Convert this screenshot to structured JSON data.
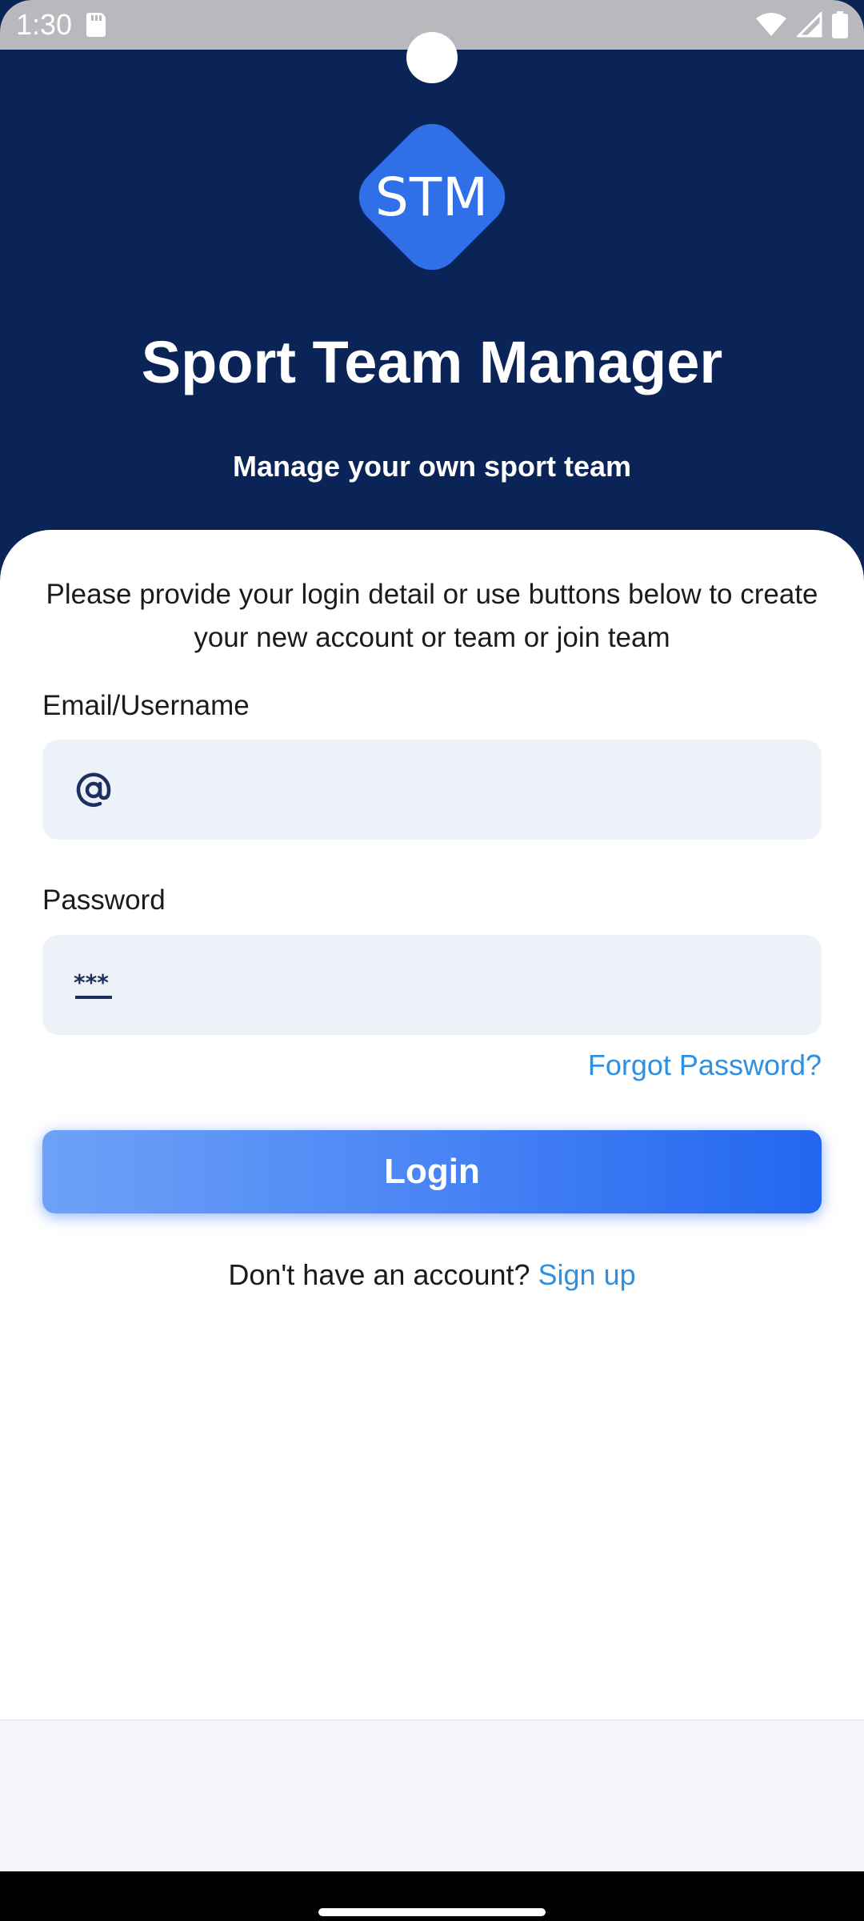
{
  "status_bar": {
    "time": "1:30"
  },
  "header": {
    "logo_text": "STM",
    "title": "Sport Team Manager",
    "subtitle": "Manage your own sport team"
  },
  "login_form": {
    "intro": "Please provide your login detail or use buttons below to create your new account or team or join team",
    "email_label": "Email/Username",
    "email_value": "",
    "password_label": "Password",
    "password_value": "",
    "forgot_password": "Forgot Password?",
    "login_button": "Login",
    "signup_prompt": "Don't have an account?",
    "signup_link": "Sign up"
  },
  "colors": {
    "header_bg": "#0b2457",
    "accent": "#2f6fe8",
    "link": "#2f8fe0",
    "field_bg": "#edf2f9"
  }
}
